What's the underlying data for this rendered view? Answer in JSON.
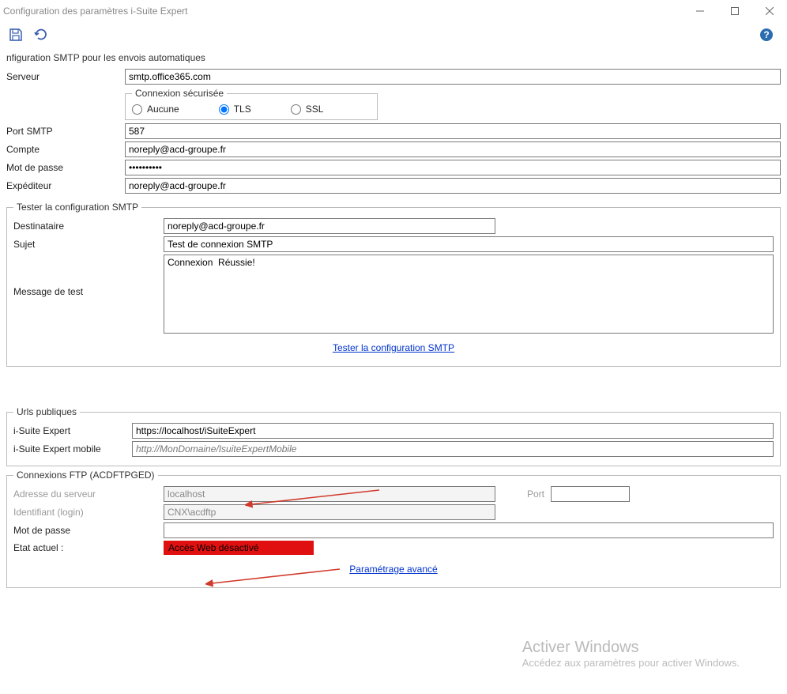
{
  "window": {
    "title": "Configuration des paramètres i-Suite Expert"
  },
  "toolbar": {
    "save_icon": "save",
    "undo_icon": "undo",
    "help_icon": "help"
  },
  "smtp": {
    "section_title": "nfiguration SMTP pour les envois automatiques",
    "server_label": "Serveur",
    "server_value": "smtp.office365.com",
    "secure_legend": "Connexion sécurisée",
    "radio_none": "Aucune",
    "radio_tls": "TLS",
    "radio_ssl": "SSL",
    "port_label": "Port SMTP",
    "port_value": "587",
    "account_label": "Compte",
    "account_value": "noreply@acd-groupe.fr",
    "password_label": "Mot de passe",
    "password_value": "••••••••••",
    "sender_label": "Expéditeur",
    "sender_value": "noreply@acd-groupe.fr"
  },
  "test": {
    "legend": "Tester la configuration SMTP",
    "recipient_label": "Destinataire",
    "recipient_value": "noreply@acd-groupe.fr",
    "subject_label": "Sujet",
    "subject_value": "Test de connexion SMTP",
    "message_label": "Message de test",
    "message_value": "Connexion  Réussie!",
    "test_link": "Tester la configuration SMTP"
  },
  "urls": {
    "legend": "Urls publiques",
    "isuite_label": "i-Suite Expert",
    "isuite_value": "https://localhost/iSuiteExpert",
    "mobile_label": "i-Suite Expert mobile",
    "mobile_placeholder": "http://MonDomaine/IsuiteExpertMobile"
  },
  "ftp": {
    "legend": "Connexions FTP (ACDFTPGED)",
    "server_label": "Adresse du serveur",
    "server_value": "localhost",
    "port_label": "Port",
    "port_value": "",
    "login_label": "Identifiant (login)",
    "login_value": "CNX\\acdftp",
    "password_label": "Mot de passe",
    "password_value": "",
    "state_label": "Etat actuel :",
    "state_value": "Accès Web désactivé",
    "advanced_link": "Paramétrage avancé"
  },
  "watermark": {
    "title": "Activer Windows",
    "sub": "Accédez aux paramètres pour activer Windows."
  }
}
